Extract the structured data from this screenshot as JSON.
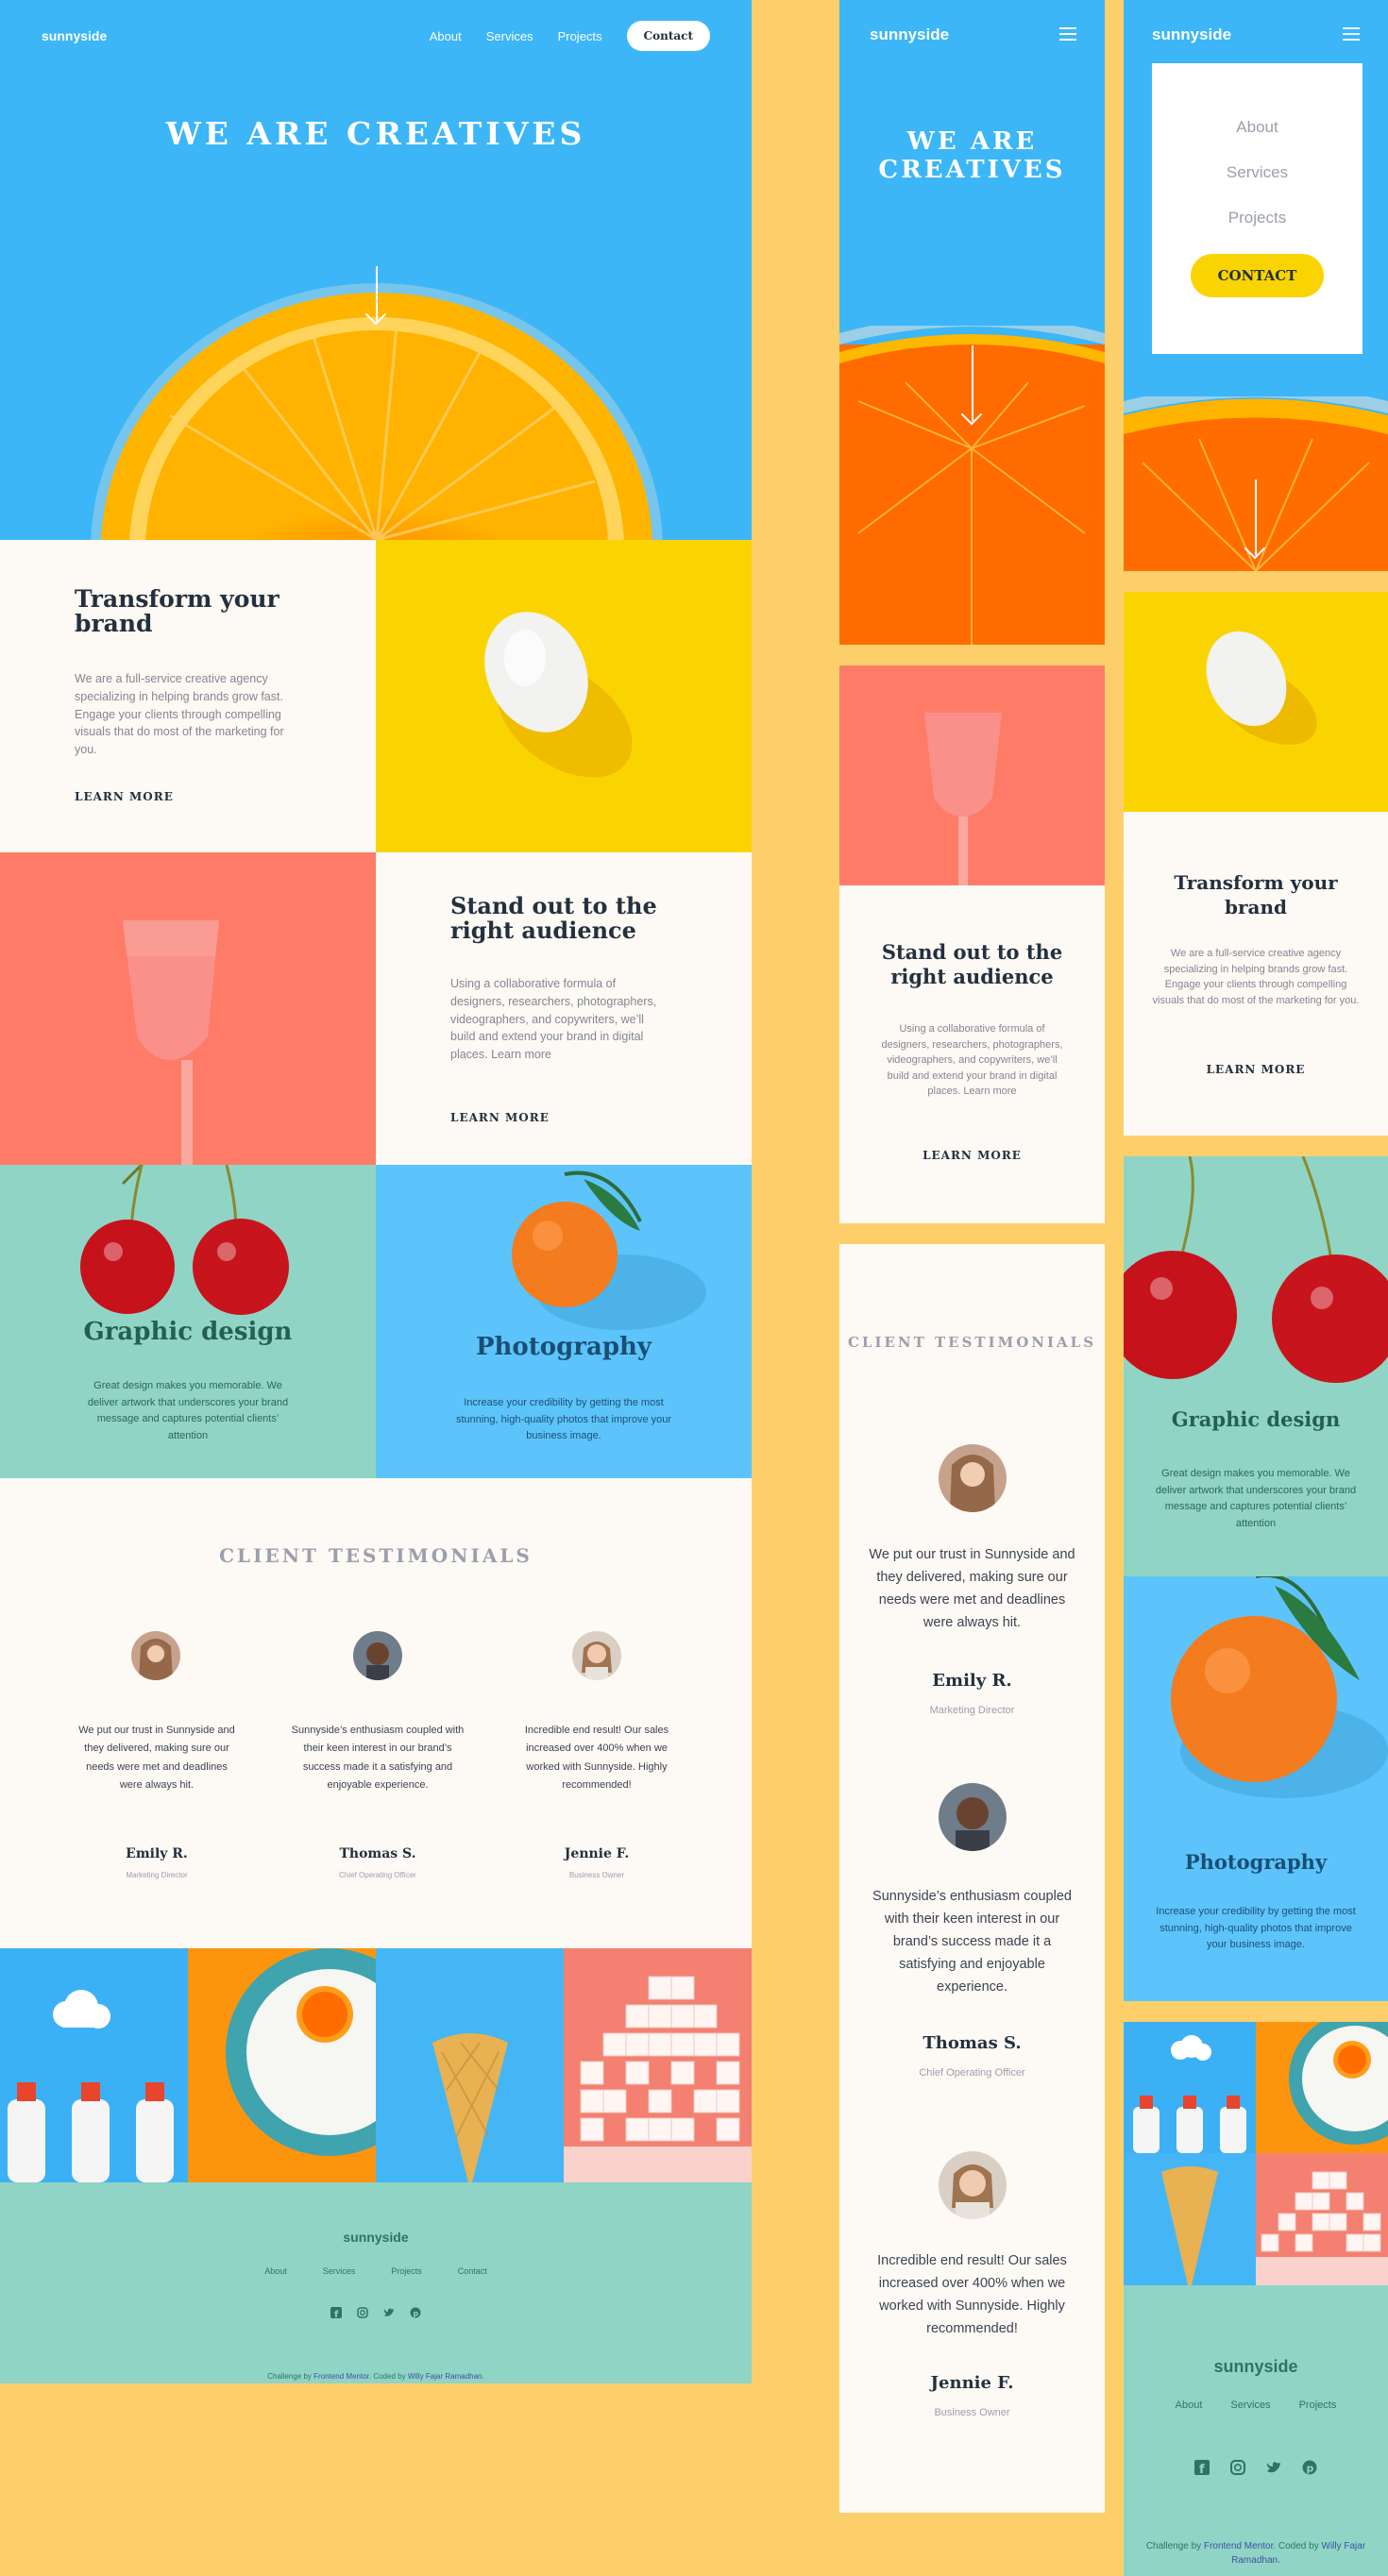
{
  "brand": "sunnyside",
  "nav": {
    "about": "About",
    "services": "Services",
    "projects": "Projects",
    "contact": "Contact",
    "contact_mobile": "CONTACT"
  },
  "hero": {
    "title": "WE ARE CREATIVES",
    "title_line1": "WE ARE",
    "title_line2": "CREATIVES"
  },
  "transform": {
    "title": "Transform your brand",
    "title_line1": "Transform your",
    "title_line2": "brand",
    "text": "We are a full-service creative agency specializing in helping brands grow fast. Engage your clients through compelling visuals that do most of the marketing for you.",
    "link": "LEARN MORE"
  },
  "standout": {
    "title": "Stand out to the right audience",
    "title_line1": "Stand out to the",
    "title_line2": "right audience",
    "text": "Using a collaborative formula of designers, researchers, photographers, videographers, and copywriters, we’ll build and extend your brand in digital places. Learn more",
    "link": "LEARN MORE"
  },
  "services": {
    "graphic": {
      "title": "Graphic design",
      "text": "Great design makes you memorable. We deliver artwork that underscores your brand message and captures potential clients’ attention"
    },
    "photo": {
      "title": "Photography",
      "text": "Increase your credibility by getting the most stunning, high-quality photos that improve your business image."
    }
  },
  "testimonials": {
    "title": "CLIENT TESTIMONIALS",
    "items": [
      {
        "quote": "We put our trust in Sunnyside and they delivered, making sure our needs were met and deadlines were always hit.",
        "name": "Emily R.",
        "role": "Marketing Director"
      },
      {
        "quote": "Sunnyside’s enthusiasm coupled with their keen interest in our brand’s success made it a satisfying and enjoyable experience.",
        "name": "Thomas S.",
        "role": "Chief Operating Officer"
      },
      {
        "quote": "Incredible end result! Our sales increased over 400% when we worked with Sunnyside. Highly recommended!",
        "name": "Jennie F.",
        "role": "Business Owner"
      }
    ]
  },
  "footer": {
    "logo": "sunnyside",
    "links": {
      "about": "About",
      "services": "Services",
      "projects": "Projects",
      "contact": "Contact"
    },
    "social_icons": [
      "facebook-icon",
      "instagram-icon",
      "twitter-icon",
      "pinterest-icon"
    ],
    "credit": {
      "prefix": "Challenge by",
      "fm": "Frontend Mentor",
      "mid": ". Coded by",
      "author": "Willy Fajar Ramadhan",
      "suffix": "."
    }
  },
  "colors": {
    "hero_blue": "#3cb6f6",
    "yellow": "#fad400",
    "pink": "#fe7b68",
    "teal": "#90d4c5",
    "bg_orange": "#fdcf6b",
    "dark_text": "#23303e"
  }
}
